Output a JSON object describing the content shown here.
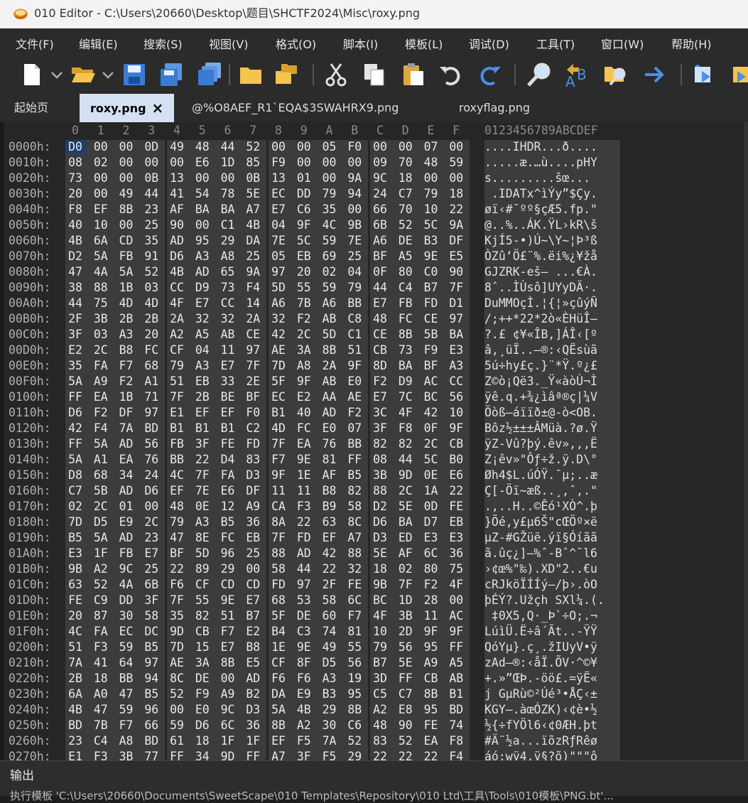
{
  "window": {
    "title": "010 Editor - C:\\Users\\20660\\Desktop\\题目\\SHCTF2024\\Misc\\roxy.png"
  },
  "menu": [
    "文件(F)",
    "编辑(E)",
    "搜索(S)",
    "视图(V)",
    "格式(O)",
    "脚本(I)",
    "模板(L)",
    "调试(D)",
    "工具(T)",
    "窗口(W)",
    "帮助(H)"
  ],
  "toolbar": {
    "icons": [
      "new-file-icon",
      "open-folder-icon",
      "save-icon",
      "save-as-icon",
      "save-all-icon",
      "open-dir-icon",
      "folders-icon",
      "cut-icon",
      "copy-icon",
      "paste-icon",
      "undo-icon",
      "redo-icon",
      "find-icon",
      "find-replace-icon",
      "find-in-files-icon",
      "goto-icon",
      "script-run-icon",
      "template-run-icon"
    ]
  },
  "tabs": [
    {
      "label": "起始页",
      "active": false
    },
    {
      "label": "roxy.png",
      "active": true,
      "close": "×"
    },
    {
      "label": "@%O8AEF_R1`EQA$3SWAHRX9.png",
      "active": false
    },
    {
      "label": "roxyflag.png",
      "active": false
    }
  ],
  "hex": {
    "col_headers": [
      "0",
      "1",
      "2",
      "3",
      "4",
      "5",
      "6",
      "7",
      "8",
      "9",
      "A",
      "B",
      "C",
      "D",
      "E",
      "F"
    ],
    "ascii_header": "0123456789ABCDEF",
    "rows": [
      {
        "offset": "0000h:",
        "bytes": "D0 00 00 0D 49 48 44 52 00 00 05 F0 00 00 07 00",
        "ascii": "....IHDR...ð...."
      },
      {
        "offset": "0010h:",
        "bytes": "08 02 00 00 00 E6 1D 85 F9 00 00 00 09 70 48 59",
        "ascii": ".....æ.…ù....pHY"
      },
      {
        "offset": "0020h:",
        "bytes": "73 00 00 0B 13 00 00 0B 13 01 00 9A 9C 18 00 00",
        "ascii": "s.........šœ..."
      },
      {
        "offset": "0030h:",
        "bytes": "20 00 49 44 41 54 78 5E EC DD 79 94 24 C7 79 18",
        "ascii": " .IDATx^ìÝy”$Çy."
      },
      {
        "offset": "0040h:",
        "bytes": "F8 EF 8B 23 AF BA BA A7 E7 C6 35 00 66 70 10 22",
        "ascii": "øï‹#¯ºº§çÆ5.fp.\""
      },
      {
        "offset": "0050h:",
        "bytes": "40 10 00 25 90 00 C1 4B 04 9F 4C 9B 6B 52 5C 9A",
        "ascii": "@..%..ÁK.ŸL›kR\\š"
      },
      {
        "offset": "0060h:",
        "bytes": "4B 6A CD 35 AD 95 29 DA 7E 5C 59 7E A6 DE B3 DF",
        "ascii": "KjÍ5-•)Ú~\\Y~¦Þ³ß"
      },
      {
        "offset": "0070h:",
        "bytes": "D2 5A FB 91 D6 A3 A8 25 05 EB 69 25 BF A5 9E E5",
        "ascii": "ÒZû‘Ö£¨%.ëi%¿¥žå"
      },
      {
        "offset": "0080h:",
        "bytes": "47 4A 5A 52 4B AD 65 9A 97 20 02 04 0F 80 C0 90",
        "ascii": "GJZRK-eš— ...€À."
      },
      {
        "offset": "0090h:",
        "bytes": "38 88 1B 03 CC D9 73 F4 5D 55 59 79 44 C4 B7 7F",
        "ascii": "8ˆ..ÌÙsô]UYyDÄ·."
      },
      {
        "offset": "00A0h:",
        "bytes": "44 75 4D 4D 4F E7 CC 14 A6 7B A6 BB E7 FB FD D1",
        "ascii": "DuMMOçÌ.¦{¦»çûýÑ"
      },
      {
        "offset": "00B0h:",
        "bytes": "2F 3B 2B 2B 2A 32 32 2A 32 F2 AB C8 48 FC CE 97",
        "ascii": "/;++*22*2ò«ÈHüÎ—"
      },
      {
        "offset": "00C0h:",
        "bytes": "3F 03 A3 20 A2 A5 AB CE 42 2C 5D C1 CE 8B 5B BA",
        "ascii": "?.£ ¢¥«ÎB,]ÁÎ‹[º"
      },
      {
        "offset": "00D0h:",
        "bytes": "E2 2C B8 FC CF 04 11 97 AE 3A 8B 51 CB 73 F9 E3",
        "ascii": "â,¸üÏ..—®:‹QËsùã"
      },
      {
        "offset": "00E0h:",
        "bytes": "35 FA F7 68 79 A3 E7 7F 7D A8 2A 9F 8D BA BF A3",
        "ascii": "5ú÷hy£ç.}¨*Ÿ.º¿£"
      },
      {
        "offset": "00F0h:",
        "bytes": "5A A9 F2 A1 51 EB 33 2E 5F 9F AB E0 F2 D9 AC CC",
        "ascii": "Z©ò¡Që3._Ÿ«àòÙ¬Ì"
      },
      {
        "offset": "0100h:",
        "bytes": "FF EA 1B 71 7F 2B BE BF EC E2 AA AE E7 7C BC 56",
        "ascii": "ÿê.q.+¾¿ìâª®ç|¼V"
      },
      {
        "offset": "0110h:",
        "bytes": "D6 F2 DF 97 E1 EF EF F0 B1 40 AD F2 3C 4F 42 10",
        "ascii": "Öòß—áïïð±@-ò<OB."
      },
      {
        "offset": "0120h:",
        "bytes": "42 F4 7A BD B1 B1 B1 C2 4D FC E0 07 3F F8 0F 9F",
        "ascii": "Bôz½±±±ÂMüà.?ø.Ÿ"
      },
      {
        "offset": "0130h:",
        "bytes": "FF 5A AD 56 FB 3F FE FD 7F EA 76 BB 82 82 2C CB",
        "ascii": "ÿZ-Vû?þý.êv»‚‚,Ë"
      },
      {
        "offset": "0140h:",
        "bytes": "5A A1 EA 76 BB 22 D4 83 F7 9E 81 FF 08 44 5C B0",
        "ascii": "Z¡êv»\"Ôƒ÷ž.ÿ.D\\°"
      },
      {
        "offset": "0150h:",
        "bytes": "D8 68 34 24 4C 7F FA D3 9F 1E AF B5 3B 9D 0E E6",
        "ascii": "Øh4$L.úÓŸ.¯µ;..æ"
      },
      {
        "offset": "0160h:",
        "bytes": "C7 5B AD D6 EF 7E E6 DF 11 11 B8 82 88 2C 1A 22",
        "ascii": "Ç[-Öï~æß..¸‚ˆ,.\""
      },
      {
        "offset": "0170h:",
        "bytes": "02 2C 01 00 48 0E 12 A9 CA F3 B9 58 D2 5E 0D FE",
        "ascii": ".,..H..©Êó¹XÒ^.þ"
      },
      {
        "offset": "0180h:",
        "bytes": "7D D5 E9 2C 79 A3 B5 36 8A 22 63 8C D6 BA D7 EB",
        "ascii": "}Õé,y£µ6Š\"cŒÖº×ë"
      },
      {
        "offset": "0190h:",
        "bytes": "B5 5A AD 23 47 8E FC EB 7F FD EF A7 D3 ED E3 E3",
        "ascii": "µZ-#GŽüë.ýï§Óíãã"
      },
      {
        "offset": "01A0h:",
        "bytes": "E3 1F FB E7 BF 5D 96 25 88 AD 42 88 5E AF 6C 36",
        "ascii": "ã.ûç¿]–%ˆ-Bˆ^¯l6"
      },
      {
        "offset": "01B0h:",
        "bytes": "9B A2 9C 25 22 89 29 00 58 44 22 32 18 02 80 75",
        "ascii": "›¢œ%\"‰).XD\"2..€u"
      },
      {
        "offset": "01C0h:",
        "bytes": "63 52 4A 6B F6 CF CD CD FD 97 2F FE 9B 7F F2 4F",
        "ascii": "cRJköÏÍÍý—/þ›.òO"
      },
      {
        "offset": "01D0h:",
        "bytes": "FE C9 DD 3F 7F 55 9E E7 68 53 58 6C BC 1D 28 00",
        "ascii": "þÉÝ?.Užçh SXl¼.(."
      },
      {
        "offset": "01E0h:",
        "bytes": "20 87 30 58 35 82 51 B7 5F DE 60 F7 4F 3B 11 AC",
        "ascii": " ‡0X5‚Q·_Þ`÷O;.¬"
      },
      {
        "offset": "01F0h:",
        "bytes": "4C FA EC DC 9D CB F7 E2 B4 C3 74 81 10 2D 9F 9F",
        "ascii": "LúìÜ.Ë÷â´Ãt..-ŸŸ"
      },
      {
        "offset": "0200h:",
        "bytes": "51 F3 59 B5 7D 15 E7 B8 1E 9E 49 55 79 56 95 FF",
        "ascii": "QóYµ}.ç¸.žIUyV•ÿ"
      },
      {
        "offset": "0210h:",
        "bytes": "7A 41 64 97 AE 3A 8B E5 CF 8F D5 56 B7 5E A9 A5",
        "ascii": "zAd—®:‹åÏ.ÕV·^©¥"
      },
      {
        "offset": "0220h:",
        "bytes": "2B 18 BB 94 8C DE 00 AD F6 F6 A3 19 3D FF CB AB",
        "ascii": "+.»”ŒÞ.-öö£.=ÿË«"
      },
      {
        "offset": "0230h:",
        "bytes": "6A A0 47 B5 52 F9 A9 B2 DA E9 B3 95 C5 C7 8B B1",
        "ascii": "j GµRù©²Úé³•ÅÇ‹±"
      },
      {
        "offset": "0240h:",
        "bytes": "4B 47 59 96 00 E0 9C D3 5A 4B 29 8B A2 E8 95 BD",
        "ascii": "KGY–.àœÓZK)‹¢è•½"
      },
      {
        "offset": "0250h:",
        "bytes": "BD 7B F7 66 59 D6 6C 36 8B A2 30 C6 48 90 FE 74",
        "ascii": "½{÷fYÖl6‹¢0ÆH.þt"
      },
      {
        "offset": "0260h:",
        "bytes": "23 C4 A8 BD 61 18 1F 1F EF F5 7A 52 83 52 EA F8",
        "ascii": "#Ä¨½a...ïõzRƒRêø"
      },
      {
        "offset": "0270h:",
        "bytes": "E1 F3 3B 77 FF 34 9D FF A7 3F F5 29 22 22 22 F4",
        "ascii": "áó;wÿ4.ÿ§?õ)\"\"\"ô"
      }
    ]
  },
  "output": {
    "label": "输出",
    "line": "执行模板 'C:\\Users\\20660\\Documents\\SweetScape\\010 Templates\\Repository\\010 Ltd\\工具\\Tools\\010模板\\PNG.bt'..."
  }
}
